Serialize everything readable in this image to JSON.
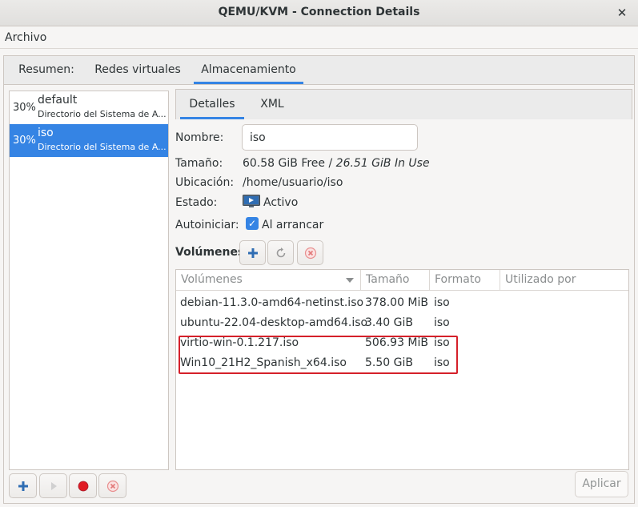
{
  "window": {
    "title": "QEMU/KVM - Connection Details",
    "close_glyph": "✕"
  },
  "menubar": {
    "archivo": "Archivo"
  },
  "tabs": [
    {
      "label": "Resumen:"
    },
    {
      "label": "Redes virtuales"
    },
    {
      "label": "Almacenamiento",
      "active": true
    }
  ],
  "pools": [
    {
      "percent": "30%",
      "name": "default",
      "description": "Directorio del Sistema de A..."
    },
    {
      "percent": "30%",
      "name": "iso",
      "description": "Directorio del Sistema de A...",
      "selected": true
    }
  ],
  "detail_tabs": [
    {
      "label": "Detalles",
      "active": true
    },
    {
      "label": "XML"
    }
  ],
  "details": {
    "name_label": "Nombre:",
    "name_value": "iso",
    "size_label": "Tamaño:",
    "size_free": "60.58 GiB Free",
    "size_sep": " / ",
    "size_inuse": "26.51 GiB In Use",
    "location_label": "Ubicación:",
    "location_value": "/home/usuario/iso",
    "state_label": "Estado:",
    "state_value": "Activo",
    "autostart_label": "Autoiniciar:",
    "autostart_value": "Al arrancar",
    "autostart_checked": true,
    "volumes_label": "Volúmenes"
  },
  "volumes_table": {
    "columns": [
      "Volúmenes",
      "Tamaño",
      "Formato",
      "Utilizado por"
    ],
    "rows": [
      {
        "name": "debian-11.3.0-amd64-netinst.iso",
        "size": "378.00 MiB",
        "format": "iso",
        "used_by": ""
      },
      {
        "name": "ubuntu-22.04-desktop-amd64.iso",
        "size": "3.40 GiB",
        "format": "iso",
        "used_by": ""
      },
      {
        "name": "virtio-win-0.1.217.iso",
        "size": "506.93 MiB",
        "format": "iso",
        "used_by": ""
      },
      {
        "name": "Win10_21H2_Spanish_x64.iso",
        "size": "5.50 GiB",
        "format": "iso",
        "used_by": ""
      }
    ]
  },
  "footer": {
    "apply_label": "Aplicar"
  },
  "colors": {
    "accent": "#3584e4",
    "highlight": "#d5202a",
    "stop": "#e01b24"
  }
}
